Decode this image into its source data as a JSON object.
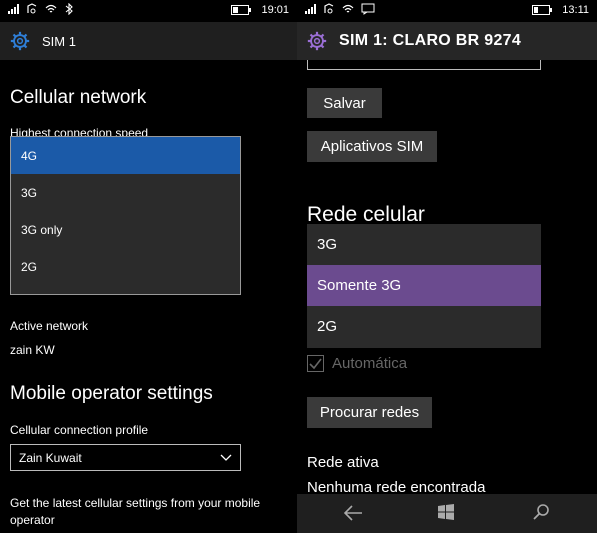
{
  "left": {
    "status": {
      "time": "19:01"
    },
    "header": {
      "title": "SIM 1"
    },
    "cellular_heading": "Cellular network",
    "speed_label": "Highest connection speed",
    "speed_options": [
      "4G",
      "3G",
      "3G only",
      "2G"
    ],
    "speed_selected": "4G",
    "active_network_label": "Active network",
    "active_network_value": "zain KW",
    "operator_heading": "Mobile operator settings",
    "profile_label": "Cellular connection profile",
    "profile_value": "Zain Kuwait",
    "latest_settings_text_1": "Get the latest cellular settings from your mobile",
    "latest_settings_text_2": "operator"
  },
  "right": {
    "status": {
      "time": "13:11"
    },
    "header": {
      "title": "SIM 1: CLARO BR 9274"
    },
    "save_button": "Salvar",
    "sim_apps_button": "Aplicativos SIM",
    "cellular_heading": "Rede celular",
    "network_options": [
      "3G",
      "Somente 3G",
      "2G"
    ],
    "network_selected": "Somente 3G",
    "automatic_label": "Automática",
    "search_networks_button": "Procurar redes",
    "active_network_label": "Rede ativa",
    "active_network_value": "Nenhuma rede encontrada"
  },
  "colors": {
    "left_accent": "#1b5aa8",
    "right_accent": "#6b4b8f",
    "gear_left": "#2f7fd8",
    "gear_right": "#9b6fd6"
  }
}
